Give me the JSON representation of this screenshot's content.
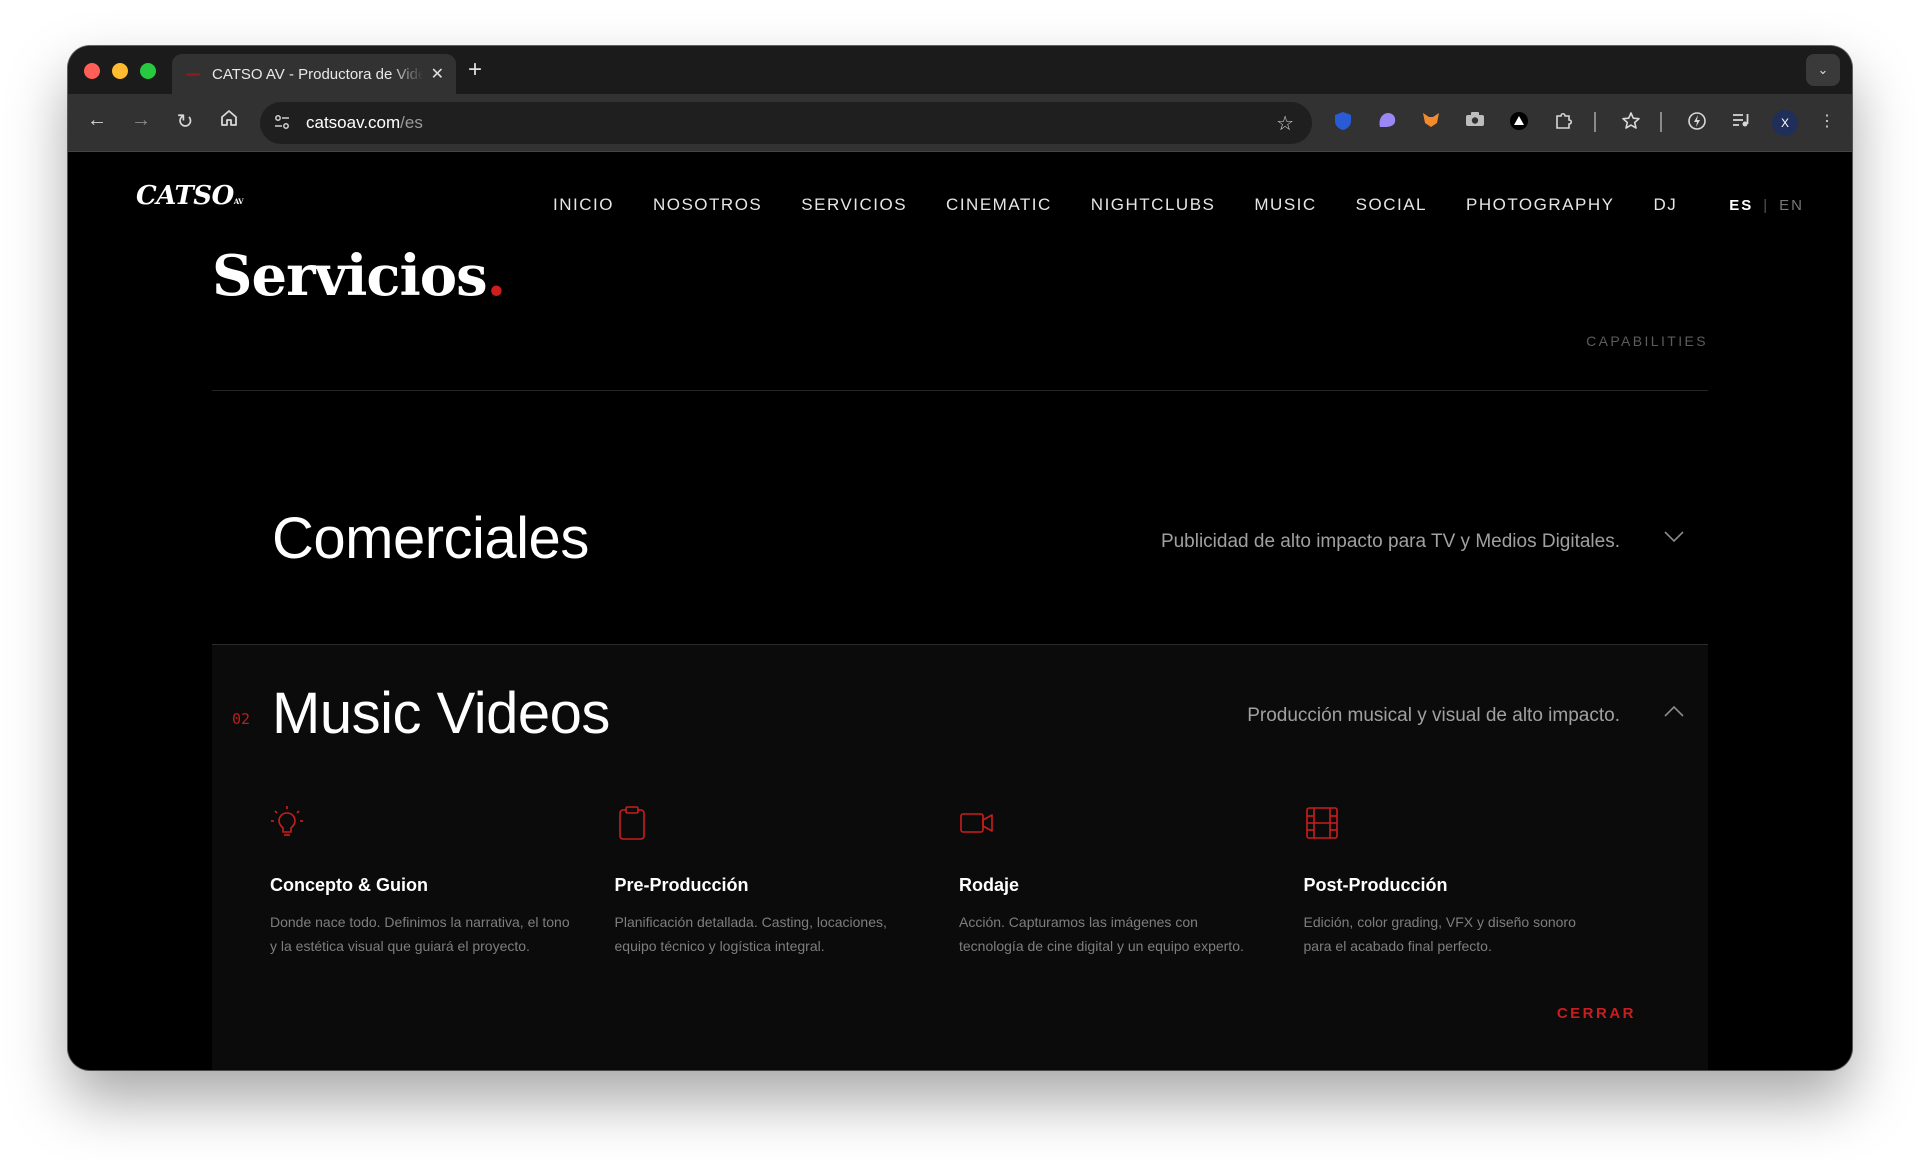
{
  "browser": {
    "tab_title": "CATSO AV - Productora de Videos",
    "new_tab_label": "+",
    "url_host": "catsoav.com",
    "url_path": "/es",
    "profile_initial": "X"
  },
  "site": {
    "logo": "CATSO",
    "logo_sub": "AV",
    "nav": [
      "INICIO",
      "NOSOTROS",
      "SERVICIOS",
      "CINEMATIC",
      "NIGHTCLUBS",
      "MUSIC",
      "SOCIAL",
      "PHOTOGRAPHY",
      "DJ"
    ],
    "lang_es": "ES",
    "lang_sep": "|",
    "lang_en": "EN"
  },
  "section": {
    "title": "Servicios",
    "title_dot": ".",
    "subtitle": "CAPABILITIES"
  },
  "accordion": [
    {
      "title": "Comerciales",
      "description": "Publicidad de alto impacto para TV y Medios Digitales.",
      "expanded": false
    },
    {
      "number": "02",
      "title": "Music Videos",
      "description": "Producción musical y visual de alto impacto.",
      "expanded": true,
      "close_label": "CERRAR",
      "steps": [
        {
          "icon": "lightbulb-icon",
          "title": "Concepto & Guion",
          "text": "Donde nace todo. Definimos la narrativa, el tono y la estética visual que guiará el proyecto."
        },
        {
          "icon": "clipboard-icon",
          "title": "Pre-Producción",
          "text": "Planificación detallada. Casting, locaciones, equipo técnico y logística integral."
        },
        {
          "icon": "video-camera-icon",
          "title": "Rodaje",
          "text": "Acción. Capturamos las imágenes con tecnología de cine digital y un equipo experto."
        },
        {
          "icon": "film-icon",
          "title": "Post-Producción",
          "text": "Edición, color grading, VFX y diseño sonoro para el acabado final perfecto."
        }
      ]
    }
  ],
  "colors": {
    "accent": "#d01e1e",
    "background": "#000000",
    "panel": "#0b0b0b"
  }
}
